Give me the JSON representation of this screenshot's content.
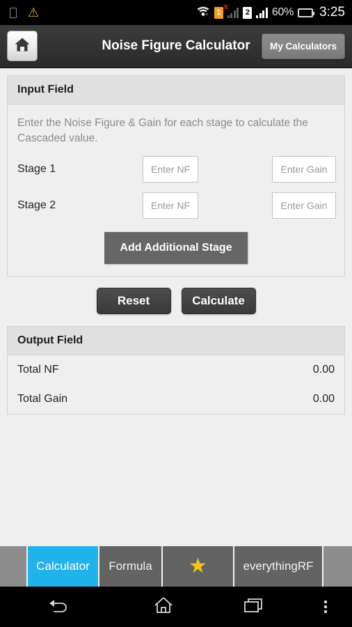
{
  "status_bar": {
    "screenshot_icon": "screenshot-icon",
    "warning_icon": "warning-icon",
    "wifi_icon": "wifi-icon",
    "sim1_label": "1",
    "sim1_error": "x",
    "sim2_label": "2",
    "battery_percent": "60%",
    "clock": "3:25"
  },
  "app_bar": {
    "home_icon": "home-icon",
    "title": "Noise Figure Calculator",
    "my_calculators_label": "My Calculators"
  },
  "input_panel": {
    "header": "Input Field",
    "instructions": "Enter the Noise Figure & Gain for each stage to calculate the Cascaded value.",
    "stages": [
      {
        "label": "Stage 1",
        "nf_value": "",
        "nf_placeholder": "Enter NF",
        "gain_value": "",
        "gain_placeholder": "Enter Gain"
      },
      {
        "label": "Stage 2",
        "nf_value": "",
        "nf_placeholder": "Enter NF",
        "gain_value": "",
        "gain_placeholder": "Enter Gain"
      }
    ],
    "add_stage_label": "Add Additional Stage"
  },
  "actions": {
    "reset_label": "Reset",
    "calculate_label": "Calculate"
  },
  "output_panel": {
    "header": "Output Field",
    "rows": [
      {
        "label": "Total NF",
        "value": "0.00"
      },
      {
        "label": "Total Gain",
        "value": "0.00"
      }
    ]
  },
  "tab_bar": {
    "tabs": [
      {
        "label": "Calculator",
        "icon": "",
        "active": true
      },
      {
        "label": "Formula",
        "icon": "",
        "active": false
      },
      {
        "label": "",
        "icon": "star-icon",
        "active": false
      },
      {
        "label": "everythingRF",
        "icon": "",
        "active": false
      }
    ],
    "active_color": "#20b2ea",
    "star_color": "#f0c419"
  },
  "nav_bar": {
    "back_icon": "back-arrow-icon",
    "home_icon": "home-icon",
    "recents_icon": "recent-apps-icon",
    "menu_icon": "overflow-menu-icon"
  }
}
